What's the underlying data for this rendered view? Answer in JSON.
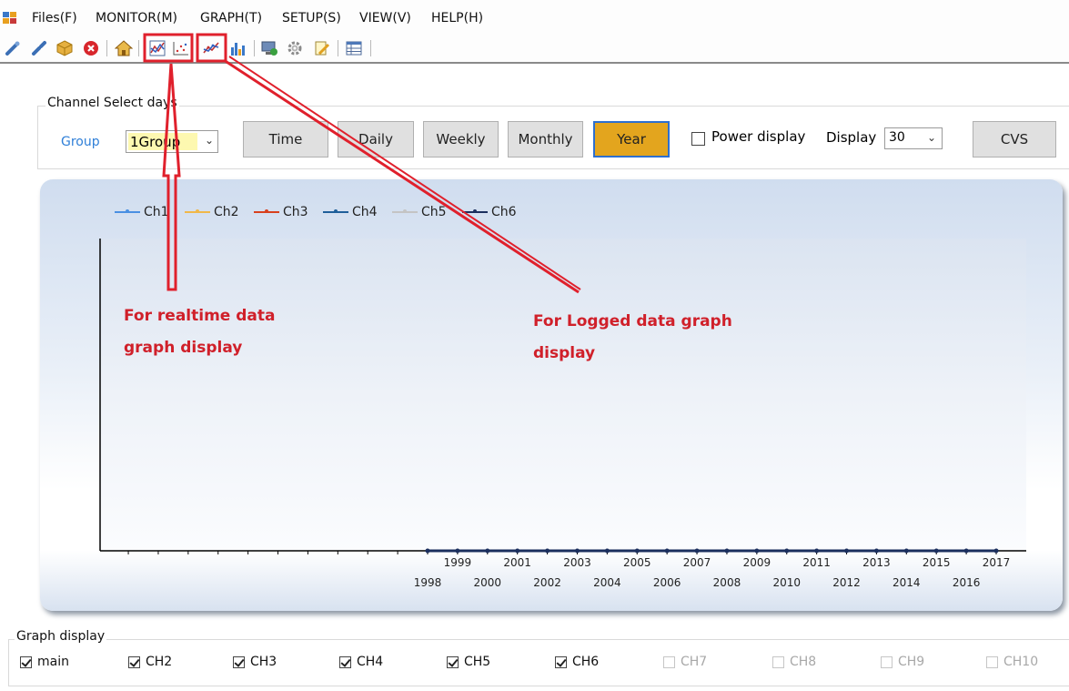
{
  "menu": {
    "items": [
      "Files(F)",
      "MONITOR(M)",
      "GRAPH(T)",
      "SETUP(S)",
      "VIEW(V)",
      "HELP(H)"
    ]
  },
  "toolbar": {
    "icons": [
      "connect-icon",
      "disconnect-icon",
      "package-icon",
      "stop-icon",
      "home-icon",
      "realtime-graph-icon",
      "realtime-scatter-icon",
      "logged-graph-icon",
      "bar-chart-icon",
      "monitor-export-icon",
      "settings-gear-icon",
      "edit-icon",
      "table-icon"
    ]
  },
  "channel_select": {
    "legend": "Channel Select days",
    "group_label": "Group",
    "group_value": "1Group",
    "buttons": [
      "Time",
      "Daily",
      "Weekly",
      "Monthly",
      "Year"
    ],
    "active_button": "Year",
    "power_display_label": "Power display",
    "power_display_checked": false,
    "display_label": "Display",
    "display_value": "30",
    "cvs_label": "CVS"
  },
  "chart_data": {
    "type": "line",
    "series": [
      {
        "name": "Ch1",
        "color": "#4a90e2"
      },
      {
        "name": "Ch2",
        "color": "#f0b84a"
      },
      {
        "name": "Ch3",
        "color": "#d8411e"
      },
      {
        "name": "Ch4",
        "color": "#1f5f9a"
      },
      {
        "name": "Ch5",
        "color": "#c4c4c4"
      },
      {
        "name": "Ch6",
        "color": "#1b2f5e"
      }
    ],
    "x": [
      1998,
      1999,
      2000,
      2001,
      2002,
      2003,
      2004,
      2005,
      2006,
      2007,
      2008,
      2009,
      2010,
      2011,
      2012,
      2013,
      2014,
      2015,
      2016,
      2017
    ],
    "x_tick_labels": [
      "1998",
      "1999",
      "2000",
      "2001",
      "2002",
      "2003",
      "2004",
      "2005",
      "2006",
      "2007",
      "2008",
      "2009",
      "2010",
      "2011",
      "2012",
      "2013",
      "2014",
      "2015",
      "2016",
      "2017"
    ],
    "values": [
      0,
      0,
      0,
      0,
      0,
      0,
      0,
      0,
      0,
      0,
      0,
      0,
      0,
      0,
      0,
      0,
      0,
      0,
      0,
      0
    ],
    "legend_position": "top-left"
  },
  "annotations": {
    "realtime_line1": "For realtime data",
    "realtime_line2": "graph display",
    "logged_line1": "For Logged data graph",
    "logged_line2": "display",
    "color": "#e0202c"
  },
  "graph_display": {
    "legend": "Graph display",
    "items": [
      {
        "label": "main",
        "checked": true,
        "enabled": true
      },
      {
        "label": "CH2",
        "checked": true,
        "enabled": true
      },
      {
        "label": "CH3",
        "checked": true,
        "enabled": true
      },
      {
        "label": "CH4",
        "checked": true,
        "enabled": true
      },
      {
        "label": "CH5",
        "checked": true,
        "enabled": true
      },
      {
        "label": "CH6",
        "checked": true,
        "enabled": true
      },
      {
        "label": "CH7",
        "checked": false,
        "enabled": false
      },
      {
        "label": "CH8",
        "checked": false,
        "enabled": false
      },
      {
        "label": "CH9",
        "checked": false,
        "enabled": false
      },
      {
        "label": "CH10",
        "checked": false,
        "enabled": false
      }
    ]
  }
}
